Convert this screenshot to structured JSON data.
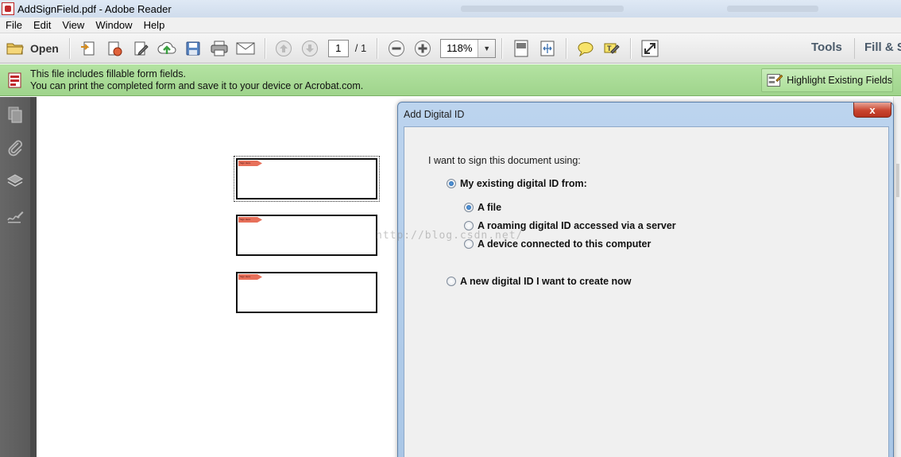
{
  "window": {
    "title": "AddSignField.pdf - Adobe Reader"
  },
  "menu": [
    "File",
    "Edit",
    "View",
    "Window",
    "Help"
  ],
  "toolbar": {
    "open_label": "Open",
    "page_current": "1",
    "page_total": "/ 1",
    "zoom": "118%",
    "tools_label": "Tools",
    "fill_sign_label": "Fill & S"
  },
  "notification": {
    "line1": "This file includes fillable form fields.",
    "line2": "You can print the completed form and save it to your device or Acrobat.com.",
    "highlight_button": "Highlight Existing Fields"
  },
  "document": {
    "signature_fields": [
      {
        "flag": "Sign Here",
        "focused": true
      },
      {
        "flag": "Sign Here",
        "focused": false
      },
      {
        "flag": "Sign Here",
        "focused": false
      }
    ]
  },
  "dialog": {
    "title": "Add Digital ID",
    "close_label": "x",
    "prompt": "I want to sign this document using:",
    "option_existing": "My existing digital ID from:",
    "sub_options": [
      {
        "label": "A file",
        "checked": true
      },
      {
        "label": "A roaming digital ID accessed via a server",
        "checked": false
      },
      {
        "label": "A device connected to this computer",
        "checked": false
      }
    ],
    "option_new": "A new digital ID I want to create now",
    "existing_checked": true,
    "new_checked": false
  },
  "watermark": "http://blog.csdn.net/"
}
